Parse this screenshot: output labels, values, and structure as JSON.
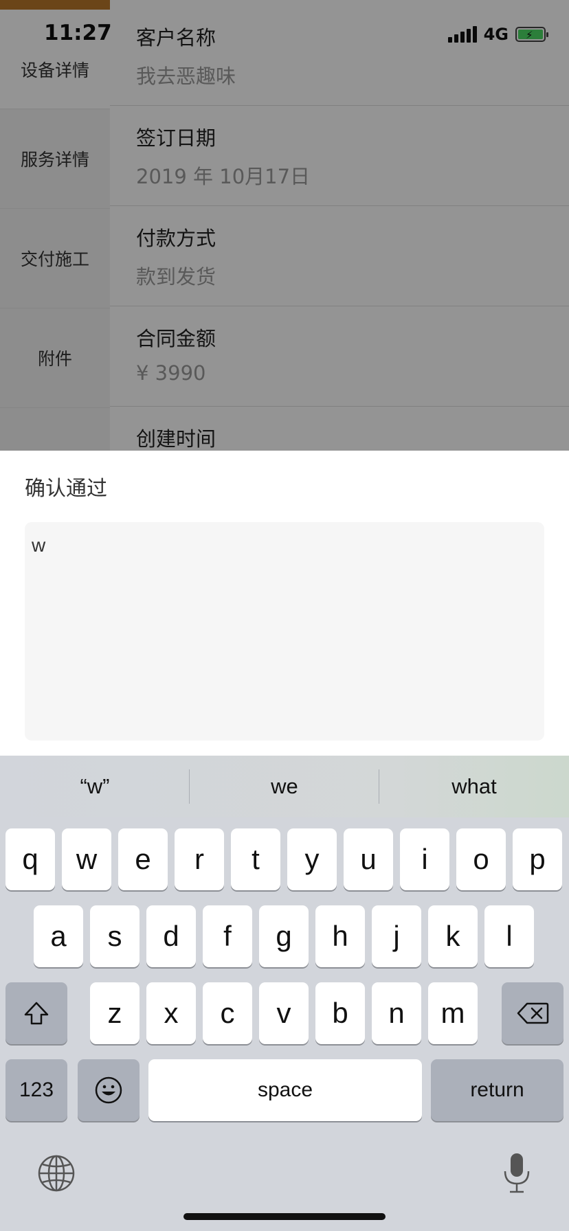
{
  "status_bar": {
    "time": "11:27",
    "network": "4G"
  },
  "sidebar": {
    "items": [
      {
        "label": "设备详情"
      },
      {
        "label": "服务详情"
      },
      {
        "label": "交付施工"
      },
      {
        "label": "附件"
      }
    ]
  },
  "details": {
    "rows": [
      {
        "label": "客户名称",
        "value": "我去恶趣味"
      },
      {
        "label": "签订日期",
        "value": "2019 年 10月17日"
      },
      {
        "label": "付款方式",
        "value": "款到发货"
      },
      {
        "label": "合同金额",
        "value": "¥ 3990"
      },
      {
        "label": "创建时间",
        "value": ""
      }
    ]
  },
  "dialog": {
    "title": "确认通过",
    "input_value": "w"
  },
  "keyboard": {
    "suggestions": [
      "“w”",
      "we",
      "what"
    ],
    "row1": [
      "q",
      "w",
      "e",
      "r",
      "t",
      "y",
      "u",
      "i",
      "o",
      "p"
    ],
    "row2": [
      "a",
      "s",
      "d",
      "f",
      "g",
      "h",
      "j",
      "k",
      "l"
    ],
    "row3": [
      "z",
      "x",
      "c",
      "v",
      "b",
      "n",
      "m"
    ],
    "numbers_label": "123",
    "space_label": "space",
    "return_label": "return"
  },
  "colors": {
    "accent_strip": "#b9772a",
    "battery": "#4cd964",
    "keyboard_bg": "#d2d5db"
  },
  "icons": [
    "signal-icon",
    "battery-icon",
    "shift-icon",
    "backspace-icon",
    "emoji-icon",
    "globe-icon",
    "microphone-icon"
  ]
}
